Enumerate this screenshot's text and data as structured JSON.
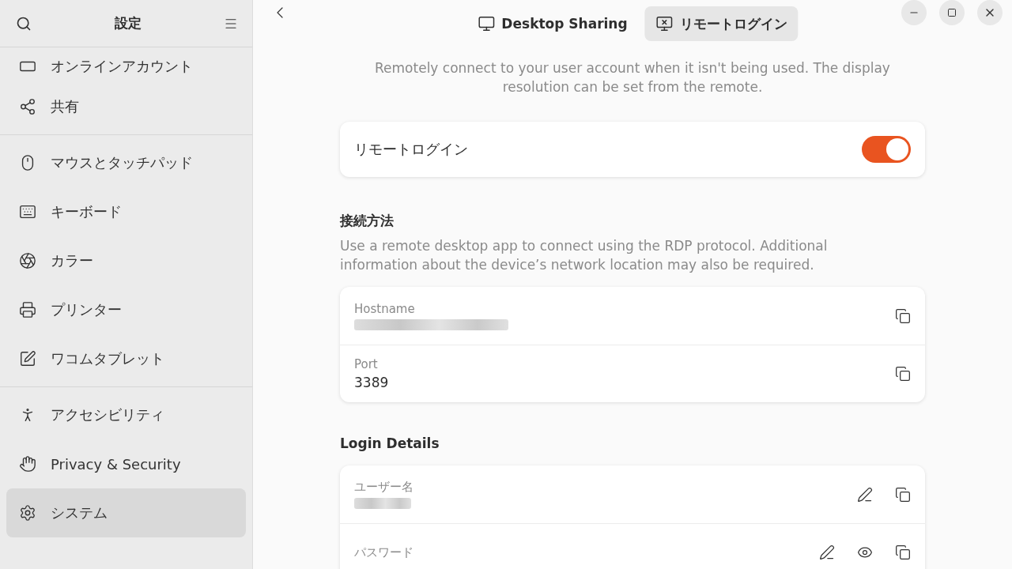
{
  "sidebar": {
    "title": "設定",
    "sections": [
      [
        {
          "label": "オンラインアカウント",
          "selected": false
        },
        {
          "label": "共有",
          "selected": false
        }
      ],
      [
        {
          "label": "マウスとタッチパッド",
          "selected": false
        },
        {
          "label": "キーボード",
          "selected": false
        },
        {
          "label": "カラー",
          "selected": false
        },
        {
          "label": "プリンター",
          "selected": false
        },
        {
          "label": "ワコムタブレット",
          "selected": false
        }
      ],
      [
        {
          "label": "アクセシビリティ",
          "selected": false
        },
        {
          "label": "Privacy & Security",
          "selected": false
        },
        {
          "label": "システム",
          "selected": true
        }
      ]
    ]
  },
  "tabs": [
    {
      "label": "Desktop Sharing",
      "selected": false
    },
    {
      "label": "リモートログイン",
      "selected": true
    }
  ],
  "intro": "Remotely connect to your user account when it isn't being used. The display resolution can be set from the remote.",
  "remote_login": {
    "label": "リモートログイン",
    "on": true
  },
  "connection": {
    "title": "接続方法",
    "description": "Use a remote desktop app to connect using the RDP protocol. Additional information about the device’s network location may also be required.",
    "rows": [
      {
        "label": "Hostname",
        "redacted": true
      },
      {
        "label": "Port",
        "value": "3389",
        "redacted": false
      }
    ]
  },
  "login": {
    "title": "Login Details",
    "rows": [
      {
        "label": "ユーザー名",
        "redacted": true
      },
      {
        "label": "パスワード",
        "redacted": false
      }
    ]
  }
}
